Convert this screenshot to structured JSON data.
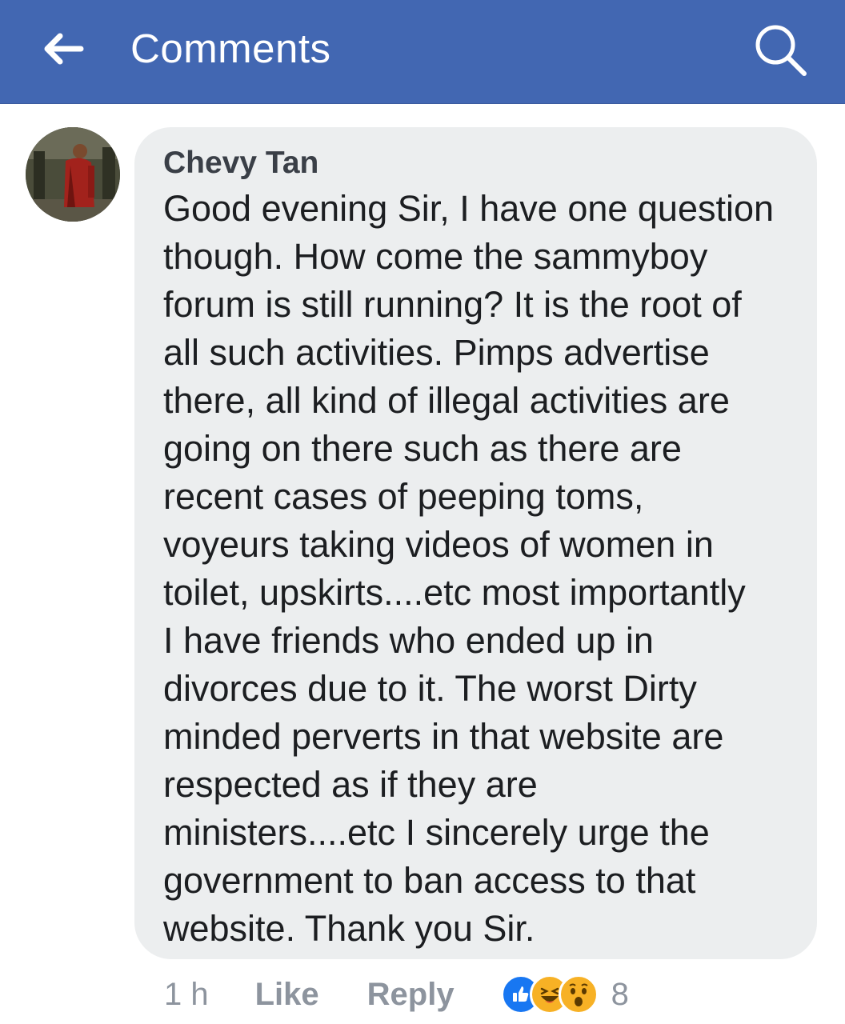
{
  "header": {
    "title": "Comments",
    "back_icon": "arrow-left-icon",
    "search_icon": "search-icon",
    "bar_color": "#4267b2"
  },
  "comment": {
    "author": "Chevy Tan",
    "text": "Good evening Sir, I have one question\nthough. How come the sammyboy\nforum is still running? It is the root of\nall such activities. Pimps advertise\nthere, all kind of illegal activities are\ngoing on there such as there are\nrecent cases of peeping toms,\nvoyeurs taking videos of women in\ntoilet, upskirts....etc most importantly\nI have friends who ended up in\ndivorces due to it. The worst Dirty\nminded perverts in that website are\nrespected as if they are\nministers....etc I sincerely urge the\ngovernment to ban access to that\nwebsite.  Thank you Sir.",
    "time": "1 h",
    "like_label": "Like",
    "reply_label": "Reply",
    "reactions": [
      "like",
      "haha",
      "wow"
    ],
    "reaction_count": "8"
  }
}
